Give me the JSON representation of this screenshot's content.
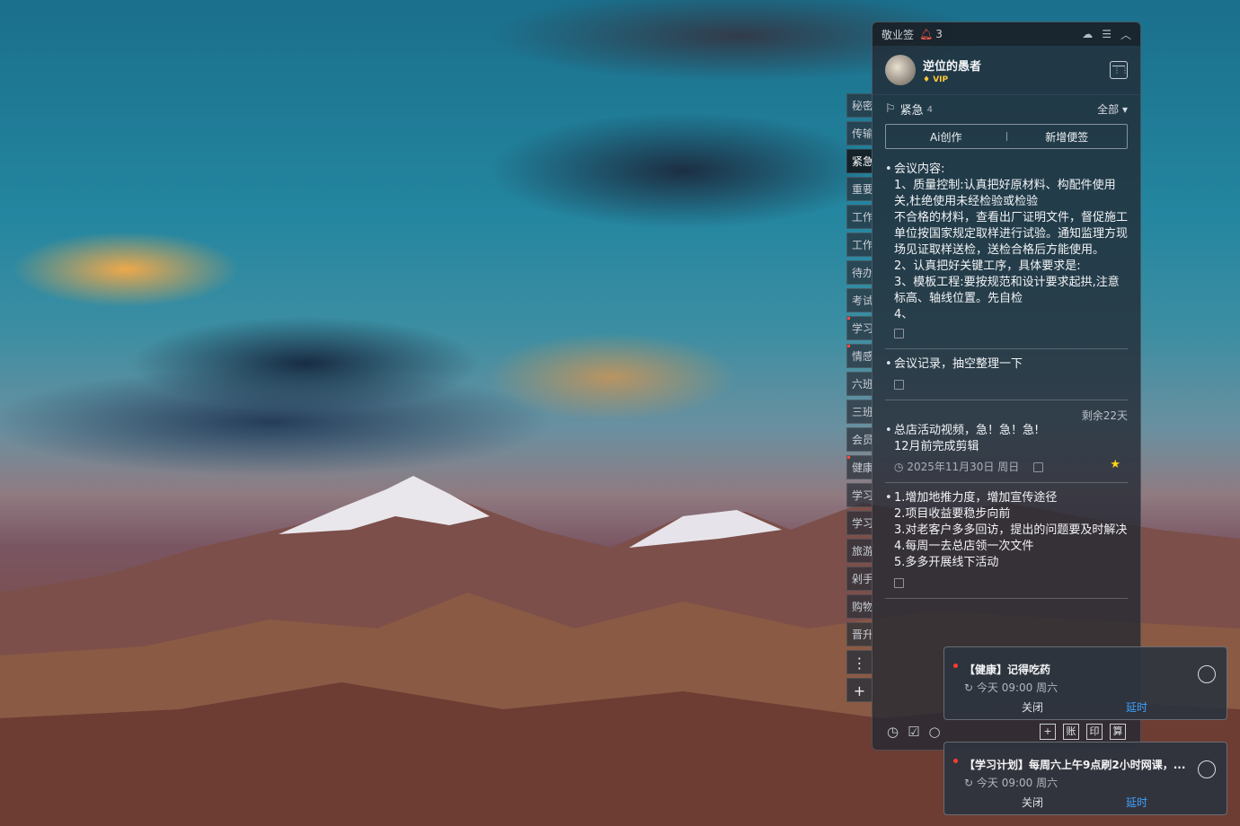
{
  "header": {
    "app_name": "敬业签",
    "reminder_count": "3"
  },
  "profile": {
    "username": "逆位的愚者",
    "badge": "VIP"
  },
  "category": {
    "name": "紧急",
    "count": "4",
    "filter": "全部"
  },
  "actions": {
    "ai_label": "Ai创作",
    "new_label": "新增便签"
  },
  "side_tabs": [
    "秘密",
    "传输",
    "紧急",
    "重要",
    "工作",
    "工作",
    "待办",
    "考试",
    "学习",
    "情感",
    "六班",
    "三班",
    "会员",
    "健康",
    "学习",
    "学习",
    "旅游",
    "剁手",
    "购物",
    "晋升"
  ],
  "notes": [
    {
      "text": "会议内容:\n1、质量控制:认真把好原材料、构配件使用关,杜绝使用未经检验或检验\n不合格的材料，查看出厂证明文件，督促施工单位按国家规定取样进行试验。通知监理方现场见证取样送检，送检合格后方能使用。\n2、认真把好关键工序，具体要求是:\n3、模板工程:要按规范和设计要求起拱,注意标高、轴线位置。先自检\n4、"
    },
    {
      "text": "会议记录，抽空整理一下"
    },
    {
      "remaining": "剩余22天",
      "text": "总店活动视频，急！急！急!\n12月前完成剪辑",
      "date": "2025年11月30日 周日"
    },
    {
      "text": "1.增加地推力度，增加宣传途径\n2.项目收益要稳步向前\n3.对老客户多多回访，提出的问题要及时解决\n4.每周一去总店领一次文件\n5.多多开展线下活动"
    }
  ],
  "bottom_tools": [
    "账",
    "印",
    "算"
  ],
  "popups": [
    {
      "title": "【健康】记得吃药",
      "time": "今天 09:00 周六",
      "close": "关闭",
      "delay": "延时"
    },
    {
      "title": "【学习计划】每周六上午9点刷2小时网课，...",
      "time": "今天 09:00 周六",
      "close": "关闭",
      "delay": "延时"
    }
  ]
}
